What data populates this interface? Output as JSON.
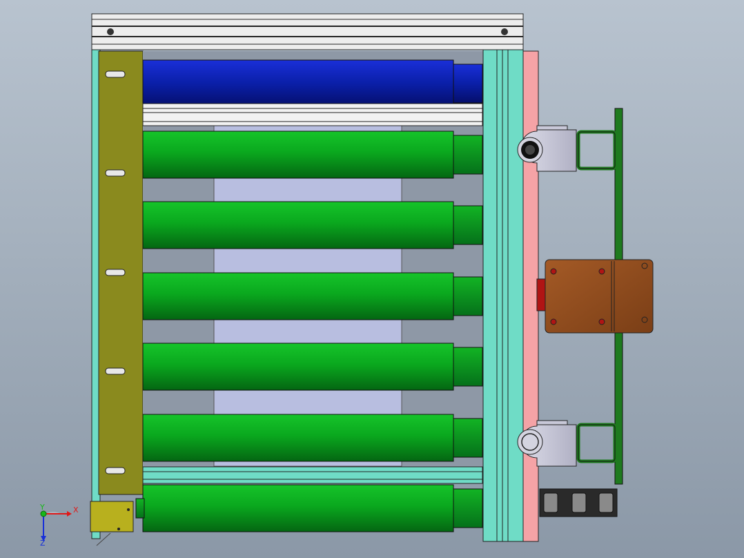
{
  "viewport": {
    "background_top": "#b8c3cf",
    "background_bottom": "#8b98a7"
  },
  "colors": {
    "frame_profile": "#e6e6e6",
    "frame_slot": "#1a1a1a",
    "side_rail": "#6fdcc6",
    "pink_rail": "#f5a3a6",
    "mounting_plate": "#8a8a1e",
    "drive_roller": "#0a1fa8",
    "conveyor_roller": "#0a9a1a",
    "belt_area": "#b8bee0",
    "motor_housing": "#8b4a1e",
    "motor_red": "#b01414",
    "bracket": "#c8c8d8",
    "green_frame": "#1e7a1e",
    "cable_chain": "#1c1c1c",
    "terminal_box": "#b8b01e"
  },
  "components": {
    "drive_roller_count": 1,
    "conveyor_roller_count": 6,
    "mounting_slots": 5,
    "side_brackets": 2,
    "motor_units": 1
  },
  "triad": {
    "x_label": "X",
    "y_label": "Y",
    "z_label": "Z",
    "x_color": "#e01818",
    "y_color": "#18b818",
    "z_color": "#1830d8"
  }
}
